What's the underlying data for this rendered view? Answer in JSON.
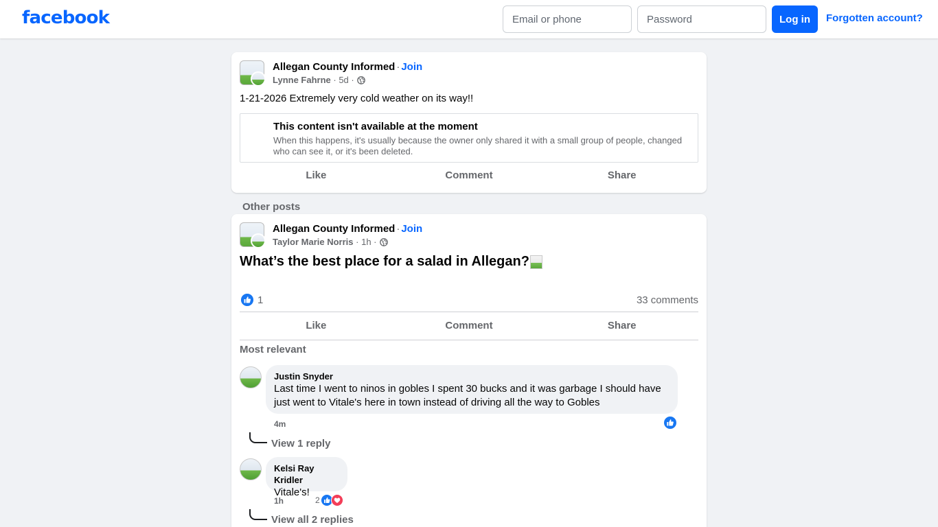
{
  "header": {
    "logo": "facebook",
    "email_placeholder": "Email or phone",
    "password_placeholder": "Password",
    "login_label": "Log in",
    "forgot_label": "Forgotten account?"
  },
  "post1": {
    "group": "Allegan County Informed",
    "join": "Join",
    "author": "Lynne Fahrne",
    "time": "5d",
    "text": "1-21-2026 Extremely very cold weather on its way!!",
    "unavailable_title": "This content isn't available at the moment",
    "unavailable_desc": "When this happens, it's usually because the owner only shared it with a small group of people, changed who can see it, or it's been deleted.",
    "actions": [
      "Like",
      "Comment",
      "Share"
    ]
  },
  "other_posts_label": "Other posts",
  "post2": {
    "group": "Allegan County Informed",
    "join": "Join",
    "author": "Taylor Marie Norris",
    "time": "1h",
    "text": "What’s the best place for a salad in Allegan?",
    "likes": "1",
    "comments": "33 comments",
    "actions": [
      "Like",
      "Comment",
      "Share"
    ],
    "sort_label": "Most relevant",
    "comment_list": [
      {
        "name": "Justin Snyder",
        "text": "Last time I went to ninos in gobles I spent 30 bucks and it was garbage I should have just went to Vitale's here in town instead of driving all the way to Gobles",
        "time": "4m",
        "replies": "View 1 reply"
      },
      {
        "name": "Kelsi Ray Kridler",
        "text": "Vitale's!",
        "time": "1h",
        "reaction_count": "2",
        "replies": "View all 2 replies"
      }
    ]
  },
  "colors": {
    "brand": "#0866ff",
    "like": "#1877f2",
    "love": "#f33e58",
    "background": "#f0f2f5"
  },
  "icons": [
    "globe-icon",
    "like-icon",
    "love-icon",
    "reply-connector-icon"
  ]
}
